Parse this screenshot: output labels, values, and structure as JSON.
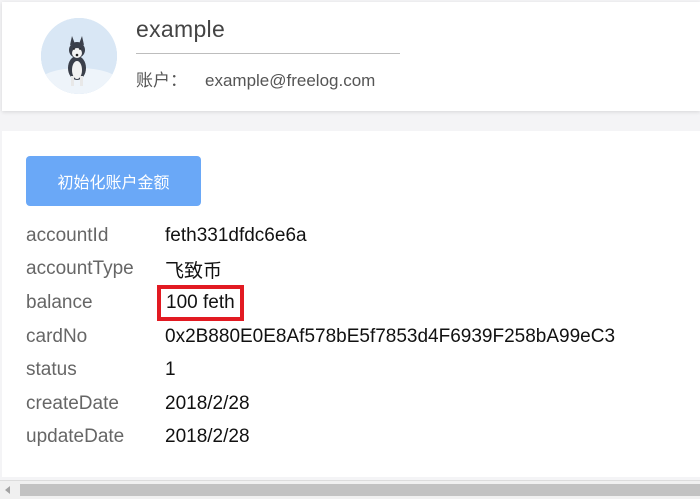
{
  "profile": {
    "avatar_icon": "husky-dog-avatar",
    "username": "example",
    "account_label": "账户：",
    "account_email": "example@freelog.com"
  },
  "actions": {
    "init_button_label": "初始化账户金额"
  },
  "account_info": [
    {
      "key": "accountId",
      "value": "feth331dfdc6e6a"
    },
    {
      "key": "accountType",
      "value": "飞致币"
    },
    {
      "key": "balance",
      "value": "100 feth"
    },
    {
      "key": "cardNo",
      "value": "0x2B880E0E8Af578bE5f7853d4F6939F258bA99eC3"
    },
    {
      "key": "status",
      "value": "1"
    },
    {
      "key": "createDate",
      "value": "2018/2/28"
    },
    {
      "key": "updateDate",
      "value": "2018/2/28"
    }
  ],
  "colors": {
    "button_bg": "#6aa8f7",
    "highlight_border": "#e21a22"
  }
}
